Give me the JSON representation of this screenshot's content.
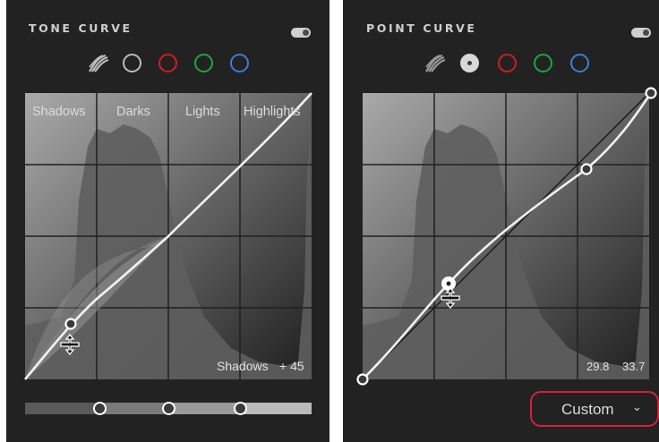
{
  "tone_curve": {
    "title": "TONE CURVE",
    "regions": [
      "Shadows",
      "Darks",
      "Lights",
      "Highlights"
    ],
    "readout_label": "Shadows",
    "readout_value": "+ 45",
    "split_handles": [
      0.25,
      0.5,
      0.75
    ]
  },
  "point_curve": {
    "title": "POINT CURVE",
    "readout_x": "29.8",
    "readout_y": "33.7",
    "preset": "Custom"
  },
  "colors": {
    "panel_bg": "#222222",
    "graph_bg": "#3a3a3a",
    "red": "#d41b24",
    "green": "#21a53d",
    "blue": "#3f7dd8",
    "highlight_border": "#d6203b"
  },
  "icons": {
    "parametric": "parametric-curve-icon",
    "rgb": "rgb-channel-icon",
    "red": "red-channel-icon",
    "green": "green-channel-icon",
    "blue": "blue-channel-icon",
    "move": "move-cursor-icon",
    "chevron": "chevron-down-icon"
  }
}
